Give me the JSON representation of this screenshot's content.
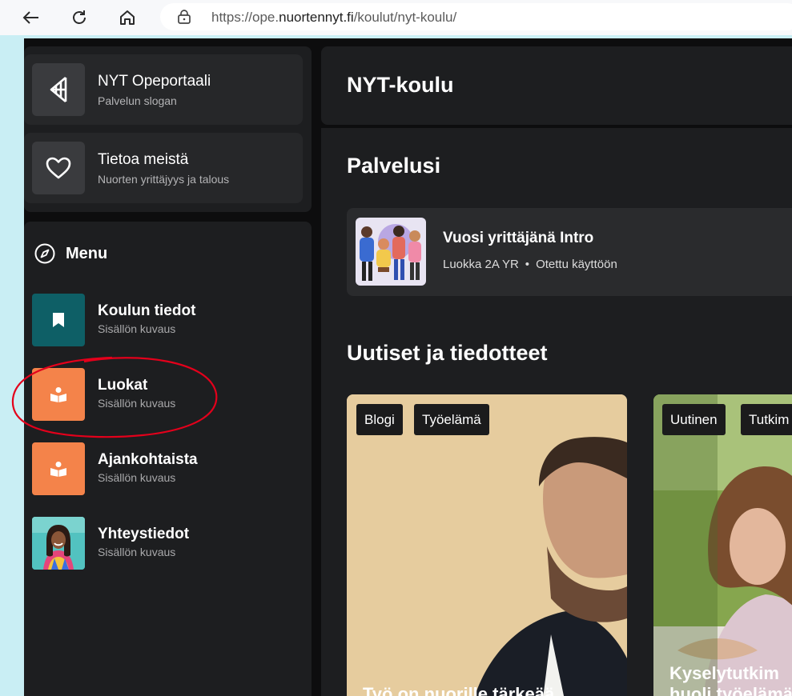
{
  "browser": {
    "url_prefix": "https://ope.",
    "url_host": "nuortennyt.fi",
    "url_path": "/koulut/nyt-koulu/"
  },
  "sidebar": {
    "top_cards": [
      {
        "title": "NYT Opeportaali",
        "subtitle": "Palvelun slogan",
        "icon": "logo-icon"
      },
      {
        "title": "Tietoa meistä",
        "subtitle": "Nuorten yrittäjyys ja talous",
        "icon": "heart-icon"
      }
    ],
    "menu_label": "Menu",
    "menu_items": [
      {
        "title": "Koulun tiedot",
        "subtitle": "Sisällön kuvaus",
        "icon": "bookmark-icon",
        "color": "#0e5f66"
      },
      {
        "title": "Luokat",
        "subtitle": "Sisällön kuvaus",
        "icon": "reader-icon",
        "color": "#f4834a"
      },
      {
        "title": "Ajankohtaista",
        "subtitle": "Sisällön kuvaus",
        "icon": "reader-icon",
        "color": "#f4834a"
      },
      {
        "title": "Yhteystiedot",
        "subtitle": "Sisällön kuvaus",
        "icon": "person-photo"
      }
    ]
  },
  "main": {
    "school_name": "NYT-koulu",
    "services_title": "Palvelusi",
    "service": {
      "title": "Vuosi yrittäjänä Intro",
      "class_label": "Luokka 2A YR",
      "bullet": "•",
      "status": "Otettu käyttöön"
    },
    "news_title": "Uutiset ja tiedotteet",
    "news": [
      {
        "tags": [
          "Blogi",
          "Työelämä"
        ],
        "title": "Työ on nuorille tärkeää"
      },
      {
        "tags": [
          "Uutinen",
          "Tutkim"
        ],
        "title_line1": "Kyselytutkim",
        "title_line2": "huoli työelämä"
      }
    ]
  },
  "colors": {
    "accent_orange": "#f4834a",
    "accent_teal": "#0e5f66",
    "annotation_red": "#e3001b"
  }
}
